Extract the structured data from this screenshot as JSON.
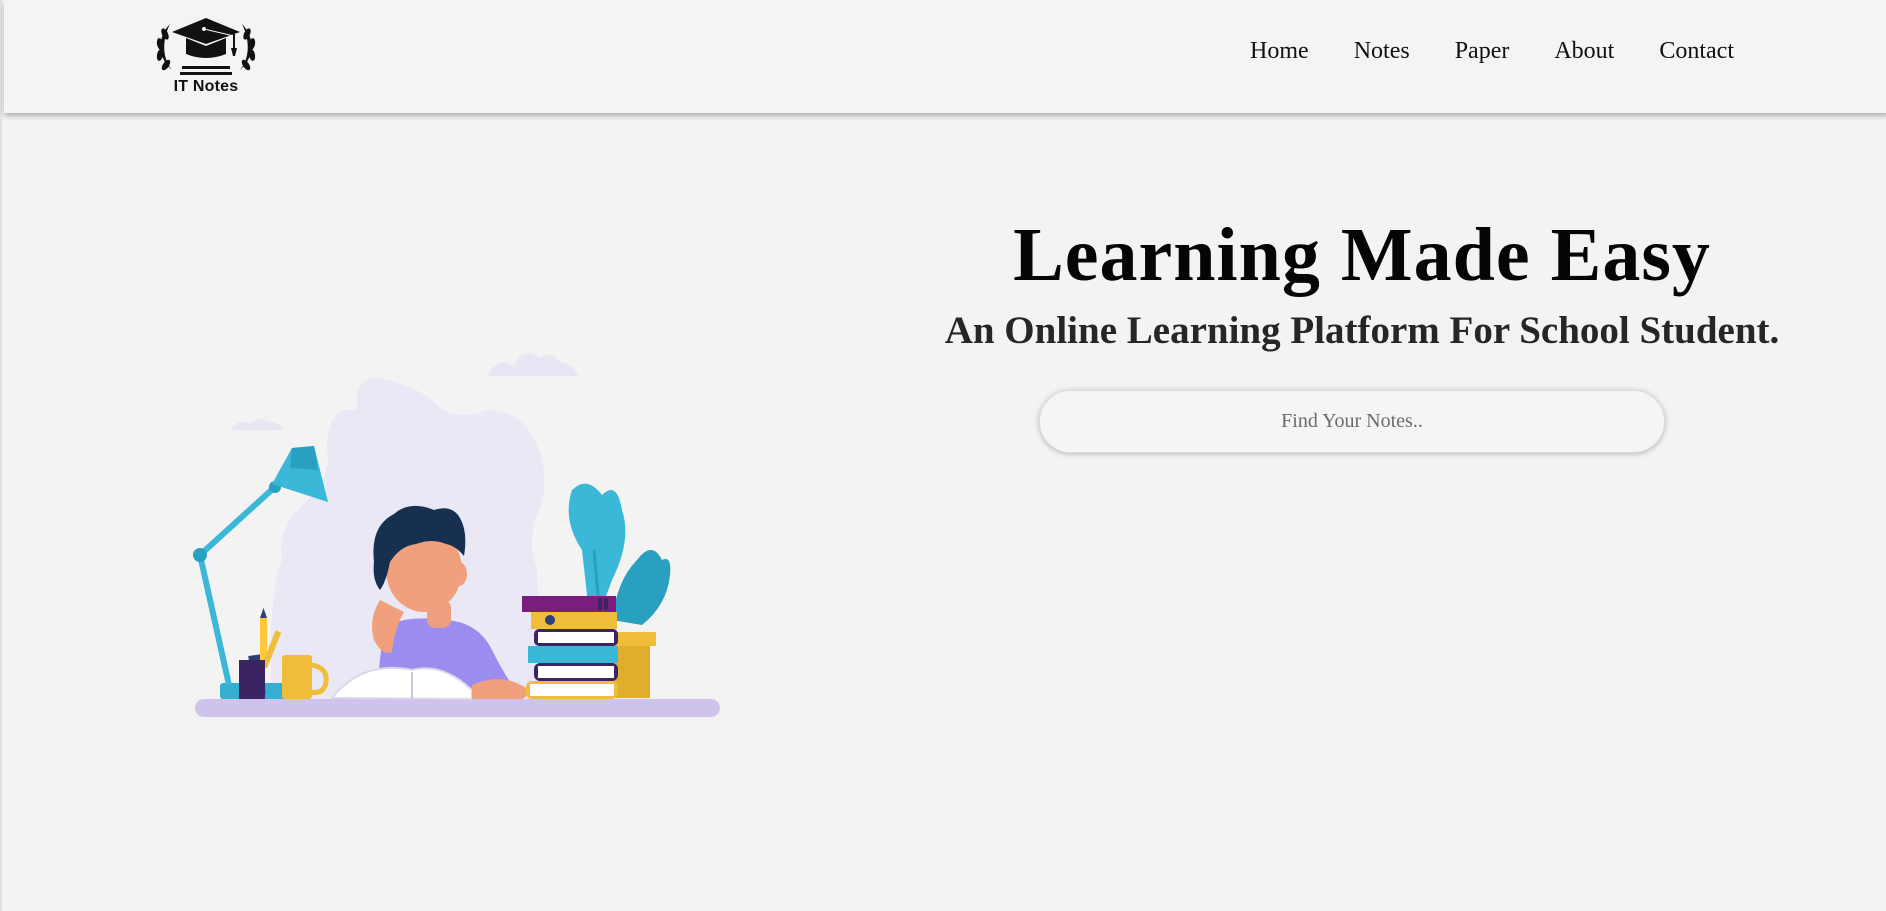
{
  "header": {
    "logo_text": "IT Notes",
    "nav": [
      {
        "label": "Home"
      },
      {
        "label": "Notes"
      },
      {
        "label": "Paper"
      },
      {
        "label": "About"
      },
      {
        "label": "Contact"
      }
    ]
  },
  "hero": {
    "title": "Learning Made Easy",
    "subtitle": "An Online Learning Platform For School Student.",
    "search": {
      "placeholder": "Find Your Notes..",
      "value": ""
    }
  },
  "illustration": {
    "icon": "student-reading-illustration"
  },
  "colors": {
    "background": "#f3f3f3",
    "accent_blue": "#3bb8d8",
    "accent_purple": "#9b8cf0",
    "accent_yellow": "#f0bd3a"
  }
}
